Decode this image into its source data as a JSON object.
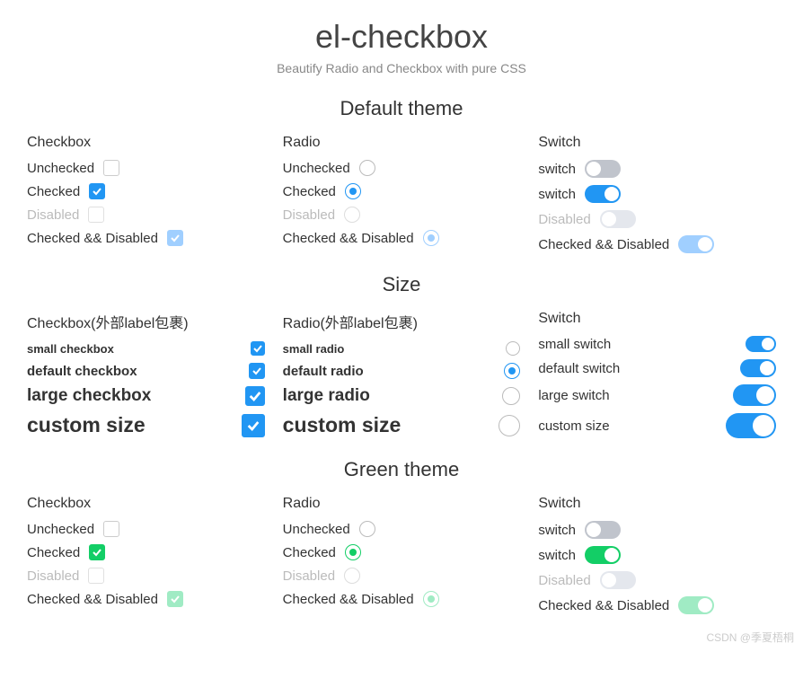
{
  "header": {
    "title": "el-checkbox",
    "subtitle": "Beautify Radio and Checkbox with pure CSS"
  },
  "sections": {
    "default": {
      "title": "Default theme",
      "checkbox_title": "Checkbox",
      "radio_title": "Radio",
      "switch_title": "Switch",
      "rows": {
        "unchecked": "Unchecked",
        "checked": "Checked",
        "disabled": "Disabled",
        "checked_disabled": "Checked && Disabled"
      },
      "switch_rows": {
        "off": "switch",
        "on": "switch",
        "disabled": "Disabled",
        "checked_disabled": "Checked && Disabled"
      }
    },
    "size": {
      "title": "Size",
      "checkbox_title": "Checkbox(外部label包裹)",
      "radio_title": "Radio(外部label包裹)",
      "switch_title": "Switch",
      "cb": {
        "sm": "small checkbox",
        "md": "default checkbox",
        "lg": "large checkbox",
        "xl": "custom size"
      },
      "rd": {
        "sm": "small radio",
        "md": "default radio",
        "lg": "large radio",
        "xl": "custom size"
      },
      "sw": {
        "sm": "small switch",
        "md": "default switch",
        "lg": "large switch",
        "xl": "custom size"
      }
    },
    "green": {
      "title": "Green theme",
      "checkbox_title": "Checkbox",
      "radio_title": "Radio",
      "switch_title": "Switch",
      "rows": {
        "unchecked": "Unchecked",
        "checked": "Checked",
        "disabled": "Disabled",
        "checked_disabled": "Checked && Disabled"
      },
      "switch_rows": {
        "off": "switch",
        "on": "switch",
        "disabled": "Disabled",
        "checked_disabled": "Checked && Disabled"
      }
    }
  },
  "watermark": "CSDN @季夏梧桐",
  "colors": {
    "blue": "#2196f3",
    "green": "#13ce66",
    "grey": "#c0c4cc"
  }
}
